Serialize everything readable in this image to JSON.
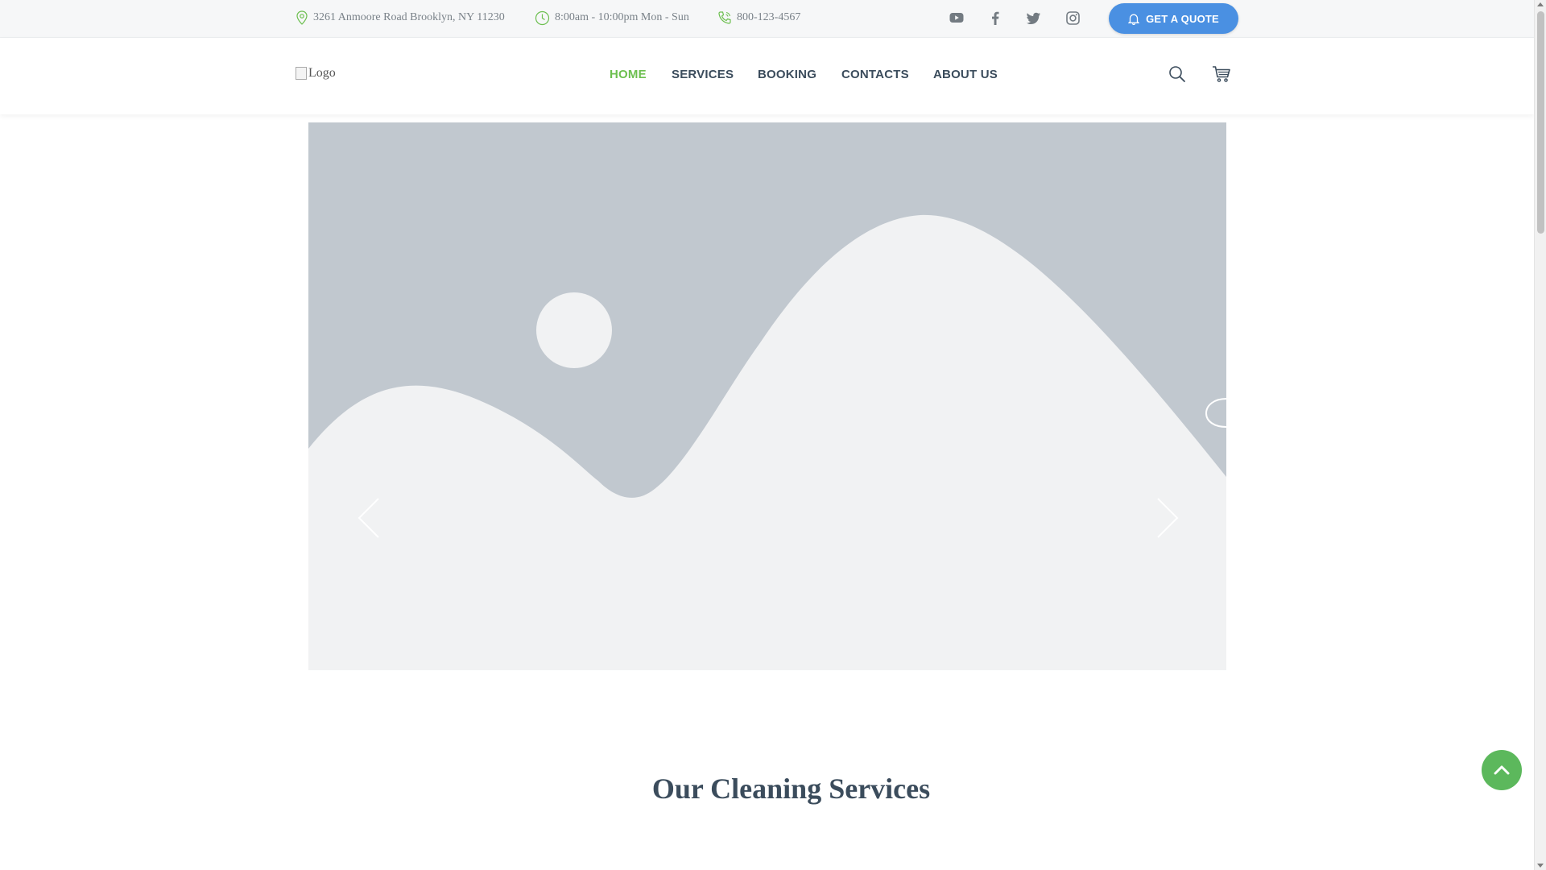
{
  "topbar": {
    "address": "3261 Anmoore Road Brooklyn, NY 11230",
    "hours": "8:00am - 10:00pm Mon - Sun",
    "phone": "800-123-4567",
    "social": [
      "youtube-icon",
      "facebook-icon",
      "twitter-icon",
      "instagram-icon"
    ],
    "quote_button": "GET A QUOTE"
  },
  "header": {
    "logo_alt": "Logo",
    "nav": [
      {
        "label": "HOME",
        "active": true
      },
      {
        "label": "SERVICES",
        "active": false
      },
      {
        "label": "BOOKING",
        "active": false
      },
      {
        "label": "CONTACTS",
        "active": false
      },
      {
        "label": "ABOUT US",
        "active": false
      }
    ],
    "icons": [
      "search-icon",
      "cart-icon"
    ]
  },
  "hero": {
    "image": "image-placeholder",
    "prev_icon": "chevron-left-icon",
    "next_icon": "chevron-right-icon"
  },
  "services": {
    "title": "Our Cleaning Services"
  },
  "colors": {
    "accent_green": "#6cbf4f",
    "button_blue": "#4a90e2",
    "text_dark": "#3b4c5c",
    "top_bar_bg": "#f6f7f8",
    "placeholder_sky": "#c1c8cf",
    "placeholder_ground": "#f1f2f3"
  },
  "back_to_top_icon": "chevron-up-icon"
}
